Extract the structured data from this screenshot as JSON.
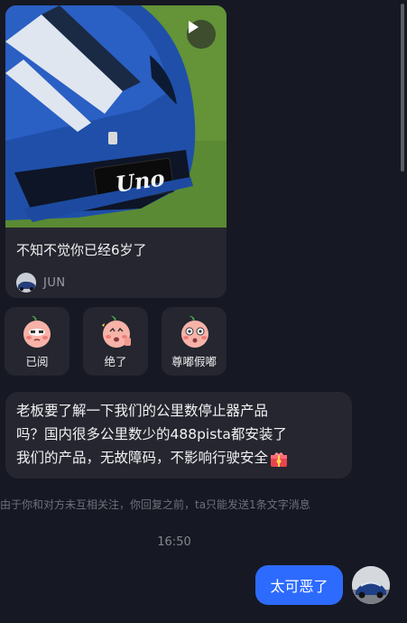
{
  "video_card": {
    "caption": "不知不觉你已经6岁了",
    "author": "JUN",
    "plate_text": "Uno"
  },
  "stickers": [
    {
      "label": "已阅"
    },
    {
      "label": "绝了"
    },
    {
      "label": "尊嘟假嘟"
    }
  ],
  "message": {
    "lines": [
      "老板要了解一下我们的公里数停止器产品",
      "吗？国内很多公里数少的488pista都安装了",
      "我们的产品，无故障码，不影响行驶安全"
    ]
  },
  "notice": "由于你和对方未互相关注，你回复之前，ta只能发送1条文字消息",
  "timestamp": "16:50",
  "reply": "太可恶了",
  "colors": {
    "background": "#161823",
    "bubble": "#25262f",
    "accent": "#2d6bff"
  }
}
